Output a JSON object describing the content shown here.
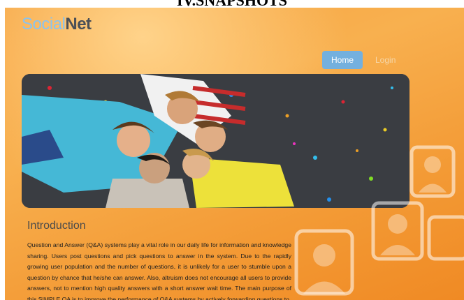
{
  "caption": "IV.SNAPSHOTS",
  "logo": {
    "part_a": "Social",
    "part_b": "Net"
  },
  "nav": {
    "home": "Home",
    "login": "Login"
  },
  "intro": {
    "title": "Introduction",
    "text": "Question and Answer (Q&A) systems play a vital role in our daily life for information and knowledge sharing. Users post questions and pick questions to answer in the system. Due to the rapidly growing user population and the number of questions, it is unlikely for a user to stumble upon a question by chance that he/she can answer. Also, altruism does not encourage all users to provide answers, not to mention high quality answers with a short answer wait time. The main purpose of this SIMPLE QA is to improve the performance of Q&A systems by actively forwarding questions to"
  },
  "colors": {
    "accent_blue": "#74b0de",
    "bg_orange": "#f6a23e"
  }
}
